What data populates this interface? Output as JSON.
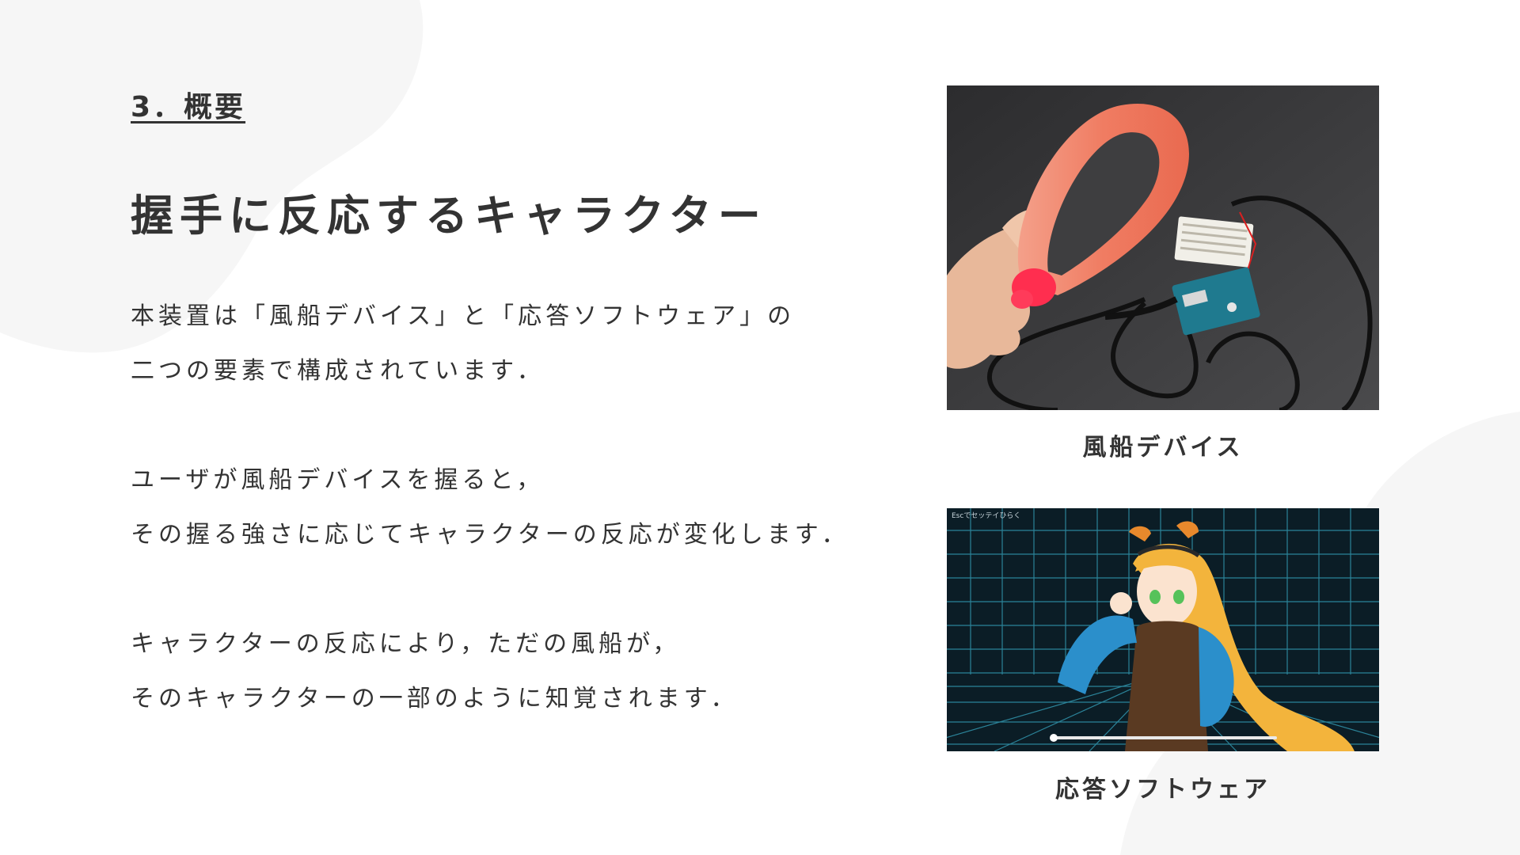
{
  "section": {
    "label": "3．概要"
  },
  "headline": "握手に反応するキャラクター",
  "body": {
    "paragraphs": [
      [
        "本装置は「風船デバイス」と「応答ソフトウェア」の",
        "二つの要素で構成されています．"
      ],
      [
        "ユーザが風船デバイスを握ると，",
        "その握る強さに応じてキャラクターの反応が変化します．"
      ],
      [
        "キャラクターの反応により，ただの風船が，",
        "そのキャラクターの一部のように知覚されます．"
      ]
    ]
  },
  "figures": {
    "device": {
      "caption": "風船デバイス"
    },
    "software": {
      "caption": "応答ソフトウェア",
      "hud_text": "Escでセッテイひらく"
    }
  },
  "colors": {
    "text": "#333333",
    "blob": "#f6f6f6",
    "balloon": "#f07c62",
    "grid": "#2f8fa6"
  },
  "icons": []
}
